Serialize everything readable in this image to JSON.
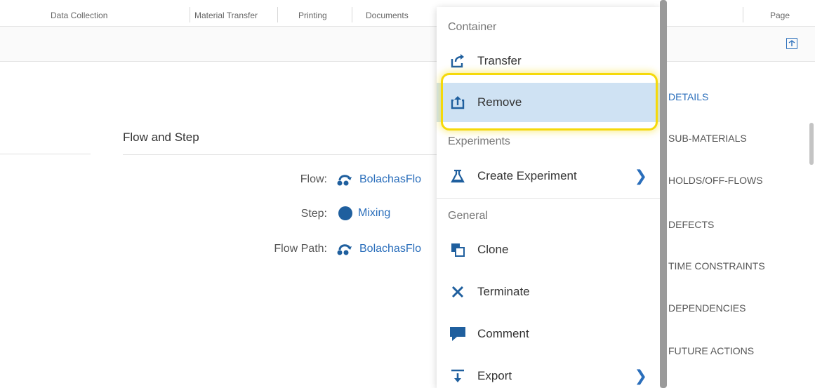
{
  "top_tabs": [
    {
      "label": "Data Collection"
    },
    {
      "label": "Material Transfer"
    },
    {
      "label": "Printing"
    },
    {
      "label": "Documents"
    },
    {
      "label": "Page"
    }
  ],
  "main": {
    "section_title": "Flow and Step",
    "fields": [
      {
        "label": "Flow:",
        "value": "BolachasFlo",
        "icon": "flow-icon"
      },
      {
        "label": "Step:",
        "value": "Mixing",
        "icon": "step-dot-icon"
      },
      {
        "label": "Flow Path:",
        "value": "BolachasFlo",
        "icon": "flow-icon"
      }
    ]
  },
  "right_nav": [
    {
      "label": "DETAILS",
      "active": true
    },
    {
      "label": "SUB-MATERIALS"
    },
    {
      "label": "HOLDS/OFF-FLOWS"
    },
    {
      "label": "DEFECTS"
    },
    {
      "label": "TIME CONSTRAINTS"
    },
    {
      "label": "DEPENDENCIES"
    },
    {
      "label": "FUTURE ACTIONS"
    }
  ],
  "menu": {
    "sections": [
      {
        "header": "Container",
        "items": [
          {
            "label": "Transfer",
            "icon": "transfer-icon"
          },
          {
            "label": "Remove",
            "icon": "remove-icon",
            "highlighted": true
          }
        ]
      },
      {
        "header": "Experiments",
        "items": [
          {
            "label": "Create Experiment",
            "icon": "flask-icon",
            "submenu": true
          }
        ]
      },
      {
        "header": "General",
        "items": [
          {
            "label": "Clone",
            "icon": "clone-icon"
          },
          {
            "label": "Terminate",
            "icon": "close-icon"
          },
          {
            "label": "Comment",
            "icon": "comment-icon"
          },
          {
            "label": "Export",
            "icon": "export-icon",
            "submenu": true
          }
        ]
      }
    ],
    "submenu_glyph": "❯"
  },
  "colors": {
    "accent": "#2a6ebb",
    "highlight": "#cfe2f3",
    "ring": "#f5d90a"
  }
}
